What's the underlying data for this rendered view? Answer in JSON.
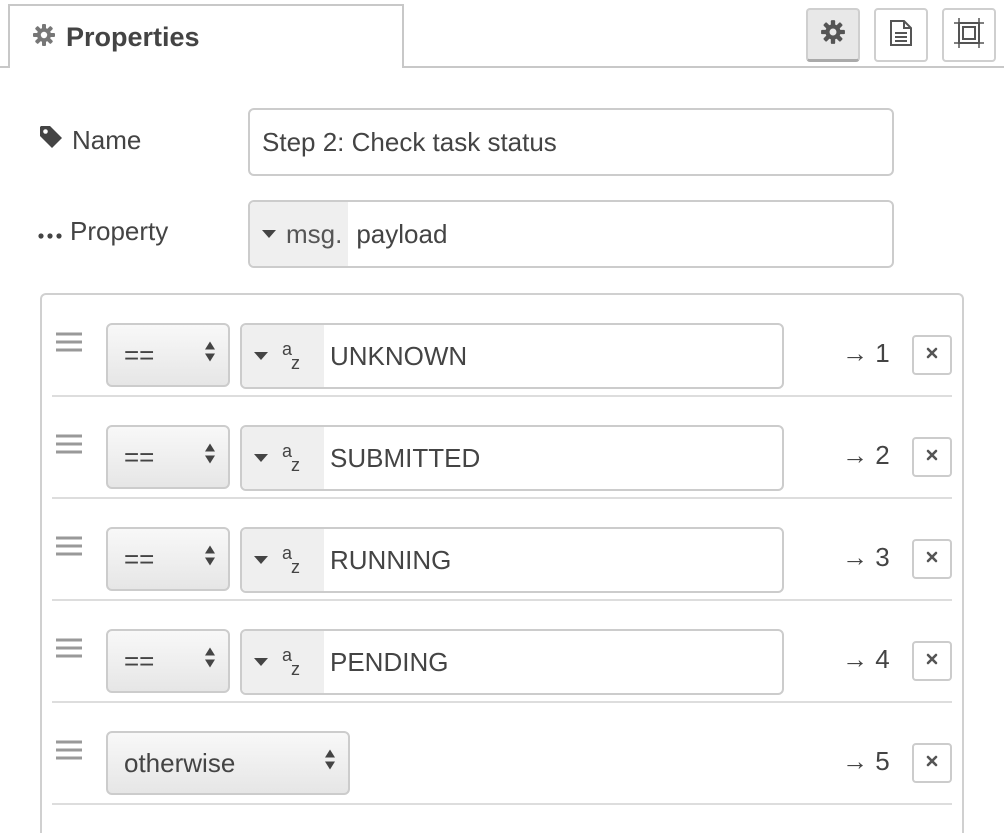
{
  "tabs": {
    "properties_label": "Properties"
  },
  "form": {
    "name_label": "Name",
    "name_value": "Step 2: Check task status",
    "property_label": "Property",
    "property_type": "msg.",
    "property_value": "payload"
  },
  "rules": [
    {
      "operator": "==",
      "value": "UNKNOWN",
      "output": "→ 1"
    },
    {
      "operator": "==",
      "value": "SUBMITTED",
      "output": "→ 2"
    },
    {
      "operator": "==",
      "value": "RUNNING",
      "output": "→ 3"
    },
    {
      "operator": "==",
      "value": "PENDING",
      "output": "→ 4"
    },
    {
      "operator": "otherwise",
      "output": "→ 5"
    }
  ],
  "colors": {
    "text": "#444444",
    "border": "#cccccc",
    "button_bg": "#efefef"
  },
  "icons": {
    "tab": "gear-icon",
    "toolbar": [
      "gear-icon",
      "document-icon",
      "frame-icon"
    ],
    "name": "tag-icon",
    "property": "ellipsis-icon",
    "rule_handle": "drag-handle-icon",
    "rule_delete": "close-icon"
  }
}
